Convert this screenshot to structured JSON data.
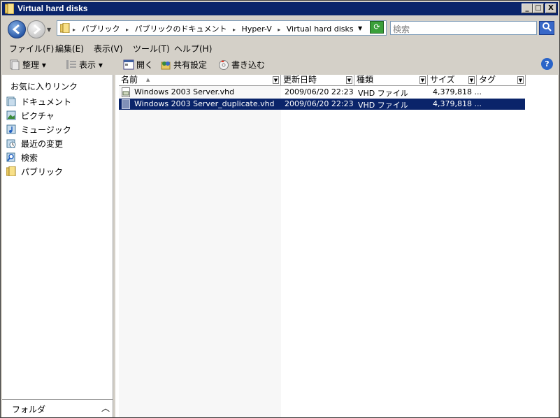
{
  "window": {
    "title": "Virtual hard disks"
  },
  "titlebar_buttons": {
    "minimize": "_",
    "maximize": "□",
    "close": "X"
  },
  "address": {
    "crumbs": [
      "パブリック",
      "パブリックのドキュメント",
      "Hyper-V",
      "Virtual hard disks"
    ],
    "separator": "▸"
  },
  "search": {
    "placeholder": "検索"
  },
  "menu": [
    "ファイル(F)",
    "編集(E)",
    "表示(V)",
    "ツール(T)",
    "ヘルプ(H)"
  ],
  "toolbar": {
    "organize": "整理 ▾",
    "views": "表示 ▾",
    "open": "開く",
    "share": "共有設定",
    "burn": "書き込む"
  },
  "navpane": {
    "title": "お気に入りリンク",
    "items": [
      "ドキュメント",
      "ピクチャ",
      "ミュージック",
      "最近の変更",
      "検索",
      "パブリック"
    ],
    "folders_label": "フォルダ"
  },
  "columns": [
    "名前",
    "更新日時",
    "種類",
    "サイズ",
    "タグ"
  ],
  "files": [
    {
      "name": "Windows 2003 Server.vhd",
      "modified": "2009/06/20 22:23",
      "type": "VHD ファイル",
      "size": "4,379,818 ..."
    },
    {
      "name": "Windows 2003 Server_duplicate.vhd",
      "modified": "2009/06/20 22:23",
      "type": "VHD ファイル",
      "size": "4,379,818 ..."
    }
  ],
  "colors": {
    "title_bar": "#0a246a",
    "selection": "#0a246a",
    "face": "#d4d0c8"
  }
}
